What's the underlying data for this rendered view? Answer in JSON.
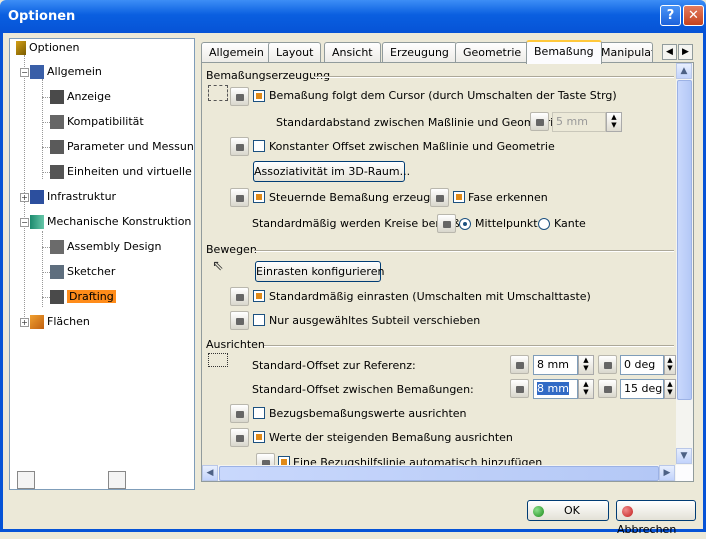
{
  "window": {
    "title": "Optionen",
    "help": "?",
    "close": "✕"
  },
  "tree": {
    "root": "Optionen",
    "items": [
      {
        "label": "Allgemein"
      },
      {
        "label": "Anzeige"
      },
      {
        "label": "Kompatibilität"
      },
      {
        "label": "Parameter und Messungen"
      },
      {
        "label": "Einheiten und virtuelle Realität"
      },
      {
        "label": "Infrastruktur"
      },
      {
        "label": "Mechanische Konstruktion"
      },
      {
        "label": "Assembly Design"
      },
      {
        "label": "Sketcher"
      },
      {
        "label": "Drafting"
      },
      {
        "label": "Flächen"
      }
    ]
  },
  "tabs": [
    "Allgemein",
    "Layout",
    "Ansicht",
    "Erzeugung",
    "Geometrie",
    "Bemaßung",
    "Manipulato"
  ],
  "active_tab": "Bemaßung",
  "sections": {
    "erzeugung": {
      "title": "Bemaßungserzeugung",
      "follow_cursor": "Bemaßung folgt dem Cursor (durch Umschalten der Taste Strg)",
      "std_distance_label": "Standardabstand zwischen Maßlinie und Geometrie:",
      "std_distance_value": "5 mm",
      "const_offset": "Konstanter Offset zwischen Maßlinie und Geometrie",
      "assoc_button": "Assoziativität im 3D-Raum...",
      "steering": "Steuernde Bemaßung erzeugen",
      "chamfer": "Fase erkennen",
      "circles_label": "Standardmäßig werden Kreise bemaßt",
      "radio_center": "Mittelpunkt",
      "radio_edge": "Kante"
    },
    "bewegen": {
      "title": "Bewegen",
      "snap_button": "Einrasten konfigurieren",
      "snap_default": "Standardmäßig einrasten (Umschalten mit Umschalttaste)",
      "move_selected": "Nur ausgewähltes Subteil verschieben"
    },
    "ausrichten": {
      "title": "Ausrichten",
      "ref_offset_label": "Standard-Offset zur Referenz:",
      "ref_offset_value": "8 mm",
      "ref_angle_value": "0 deg",
      "dim_offset_label": "Standard-Offset zwischen Bemaßungen:",
      "dim_offset_value": "8 mm",
      "dim_angle_value": "15 deg",
      "align_ref_values": "Bezugsbemaßungswerte ausrichten",
      "align_cumul_values": "Werte der steigenden Bemaßung ausrichten",
      "auto_extension": "Eine Bezugshilfslinie automatisch hinzufügen"
    }
  },
  "footer": {
    "ok": "OK",
    "cancel": "Abbrechen"
  },
  "colors": {
    "titlebar": "#0653d6",
    "selected": "#ff8c1a",
    "checkmark": "#e08a18"
  }
}
